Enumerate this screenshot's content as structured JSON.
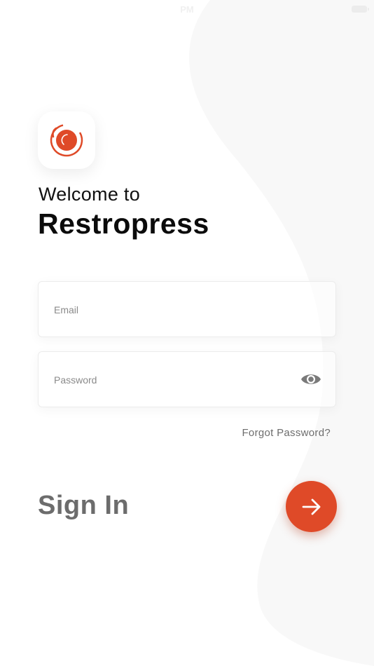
{
  "status_bar": {
    "time": "PM"
  },
  "branding": {
    "welcome_text": "Welcome to",
    "app_name": "Restropress",
    "logo_icon": "restropress-logo-icon",
    "accent_color": "#df4a28"
  },
  "login_form": {
    "email_placeholder": "Email",
    "email_value": "",
    "password_placeholder": "Password",
    "password_value": "",
    "password_toggle_icon": "eye-icon",
    "forgot_password_label": "Forgot Password?",
    "sign_in_label": "Sign In",
    "submit_icon": "arrow-right-icon"
  }
}
